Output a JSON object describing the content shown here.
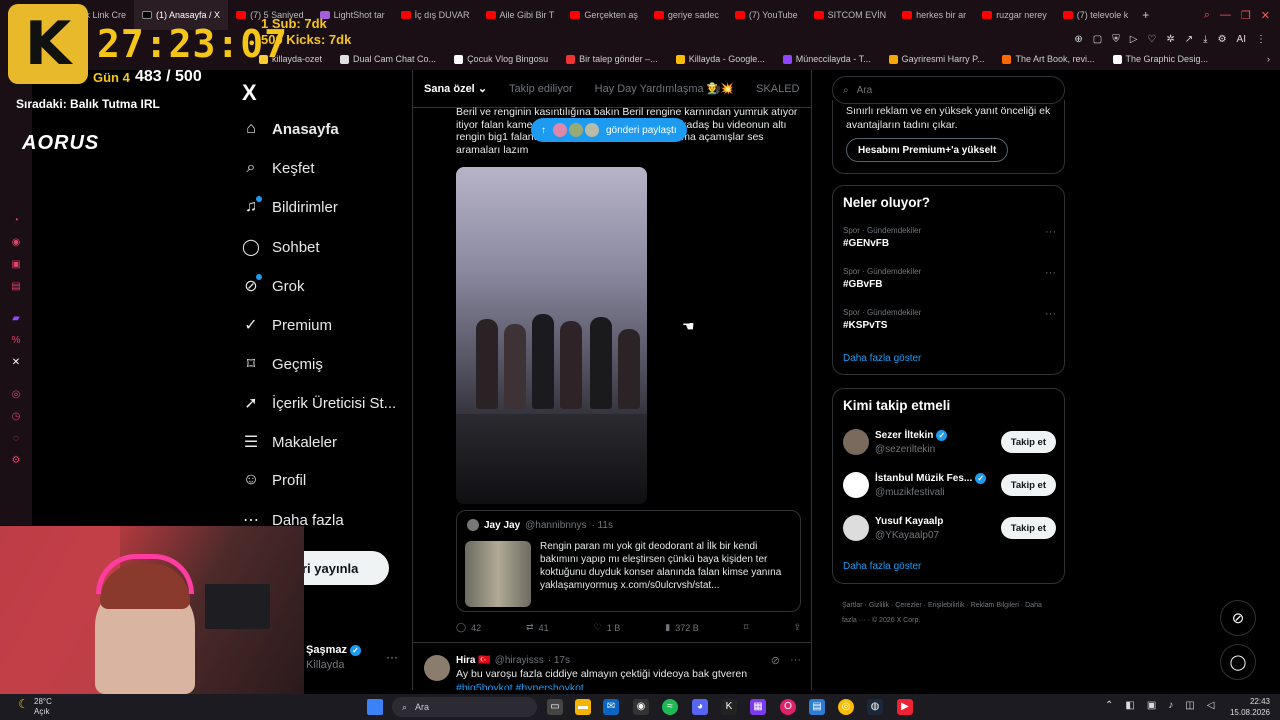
{
  "browser": {
    "tabs": [
      {
        "label": "away",
        "favicon": "generic-icon"
      },
      {
        "label": "Kick Link Cre",
        "favicon": "kick-icon"
      },
      {
        "label": "(1) Anasayfa / X",
        "favicon": "x-icon",
        "active": true
      },
      {
        "label": "(7) 5 Saniyed",
        "favicon": "youtube-icon"
      },
      {
        "label": "LightShot tar",
        "favicon": "lightshot-icon"
      },
      {
        "label": "İç dış DUVAR",
        "favicon": "youtube-icon"
      },
      {
        "label": "Aile Gibi Bir T",
        "favicon": "youtube-icon"
      },
      {
        "label": "Gerçekten aş",
        "favicon": "youtube-icon"
      },
      {
        "label": "geriye sadec",
        "favicon": "youtube-icon"
      },
      {
        "label": "(7) YouTube",
        "favicon": "youtube-icon"
      },
      {
        "label": "SITCOM EVİN",
        "favicon": "youtube-icon"
      },
      {
        "label": "herkes bir ar",
        "favicon": "youtube-icon"
      },
      {
        "label": "ruzgar nerey",
        "favicon": "youtube-icon"
      },
      {
        "label": "(7) televole k",
        "favicon": "youtube-icon"
      }
    ],
    "address_right": "AI",
    "bookmarks": [
      {
        "label": "Killayda - Kick İstat..."
      },
      {
        "label": "killayda-ozet"
      },
      {
        "label": "Dual Cam Chat Co..."
      },
      {
        "label": "Çocuk Vlog Bingosu"
      },
      {
        "label": "Bir talep gönder –..."
      },
      {
        "label": "Killayda - Google..."
      },
      {
        "label": "Müneccilayda - T..."
      },
      {
        "label": "Gayriresmi Harry P..."
      },
      {
        "label": "The Art Book, revi..."
      },
      {
        "label": "The Graphic Desig..."
      }
    ]
  },
  "overlay": {
    "logo_letter": "K",
    "timer": "27:23:07",
    "sub_line": "1 Sub: 7dk",
    "kick_line": "500 Kicks: 7dk",
    "day": "Gün 4",
    "count": "483 / 500",
    "next": "Sıradaki: Balık Tutma IRL",
    "brand": "AORUS"
  },
  "nav": {
    "logo": "X",
    "items": [
      {
        "label": "Anasayfa",
        "icon": "home-icon"
      },
      {
        "label": "Keşfet",
        "icon": "search-icon"
      },
      {
        "label": "Bildirimler",
        "icon": "bell-icon"
      },
      {
        "label": "Sohbet",
        "icon": "chat-icon"
      },
      {
        "label": "Grok",
        "icon": "grok-icon"
      },
      {
        "label": "Premium",
        "icon": "premium-icon"
      },
      {
        "label": "Geçmiş",
        "icon": "bookmark-icon"
      },
      {
        "label": "İçerik Üreticisi St...",
        "icon": "rocket-icon"
      },
      {
        "label": "Makaleler",
        "icon": "article-icon"
      },
      {
        "label": "Profil",
        "icon": "profile-icon"
      },
      {
        "label": "Daha fazla",
        "icon": "more-icon"
      }
    ],
    "post_button": "ri yayınla",
    "profile_name": "Şaşmaz",
    "profile_handle": "Killayda"
  },
  "feed": {
    "tabs": [
      "Sana özel",
      "Takip ediliyor",
      "Hay Day Yardımlaşma 👨‍🌾💥",
      "SKALED"
    ],
    "post_text": "Beril ve renginin kasıntılığına bakın Beril rengine karnından yumruk atıyor itiyor falan kamera açısından görünüyor zaten arkadaş bu videonun altı rengin big1 falandan koşuyormuş söylüyormuş ama açamışlar ses aramaları lazım",
    "new_posts_pill": "gönderi paylaştı",
    "quote": {
      "name": "Jay Jay",
      "handle": "@hannibnnys",
      "time": "· 11s",
      "text": "Rengin paran mı yok git deodorant al İlk bir kendi bakımını yapıp mı eleştirsen çünkü baya kişiden ter koktuğunu duyduk konser alanında falan kimse yanına yaklaşamıyormuş  x.com/s0ulcrvsh/stat..."
    },
    "actions": {
      "replies": "42",
      "reposts": "41",
      "likes": "1 B",
      "views": "372 B"
    },
    "post2": {
      "name": "Hira 🇹🇷",
      "handle": "@hirayisss",
      "time": "· 17s",
      "text": "Ay bu varoşu fazla ciddiye almayın çektiği videoya bak gtveren",
      "tags": "#big5boykot #hypershoykot"
    }
  },
  "right": {
    "search_placeholder": "Ara",
    "premium_text": "Sınırlı reklam ve en yüksek yanıt önceliği ek avantajların tadını çıkar.",
    "premium_button": "Hesabını Premium+'a yükselt",
    "trends_title": "Neler oluyor?",
    "trends": [
      {
        "category": "Spor · Gündemdekiler",
        "tag": "#GENvFB"
      },
      {
        "category": "Spor · Gündemdekiler",
        "tag": "#GBvFB"
      },
      {
        "category": "Spor · Gündemdekiler",
        "tag": "#KSPvTS"
      }
    ],
    "show_more": "Daha fazla göster",
    "who_title": "Kimi takip etmeli",
    "who": [
      {
        "name": "Sezer İltekin",
        "handle": "@sezeriltekin",
        "button": "Takip et"
      },
      {
        "name": "İstanbul Müzik Fes...",
        "handle": "@muzikfestivali",
        "button": "Takip et"
      },
      {
        "name": "Yusuf Kayaalp",
        "handle": "@YKayaalp07",
        "button": "Takip et"
      }
    ],
    "who_show_more": "Daha fazla göster",
    "footer": "Şartlar  ·  Gizlilik  ·  Çerezler  ·  Erişilebilirlik  ·  Reklam Bilgileri  ·  Daha fazla ···  ·  © 2026 X Corp."
  },
  "taskbar": {
    "weather_temp": "28°C",
    "weather_desc": "Açık",
    "search": "Ara",
    "time": "22:43",
    "date": "15.08.2026"
  },
  "colors": {
    "accent": "#1d9bf0",
    "overlay_yellow": "#f5c518",
    "tab_bg": "#1a0f14"
  }
}
